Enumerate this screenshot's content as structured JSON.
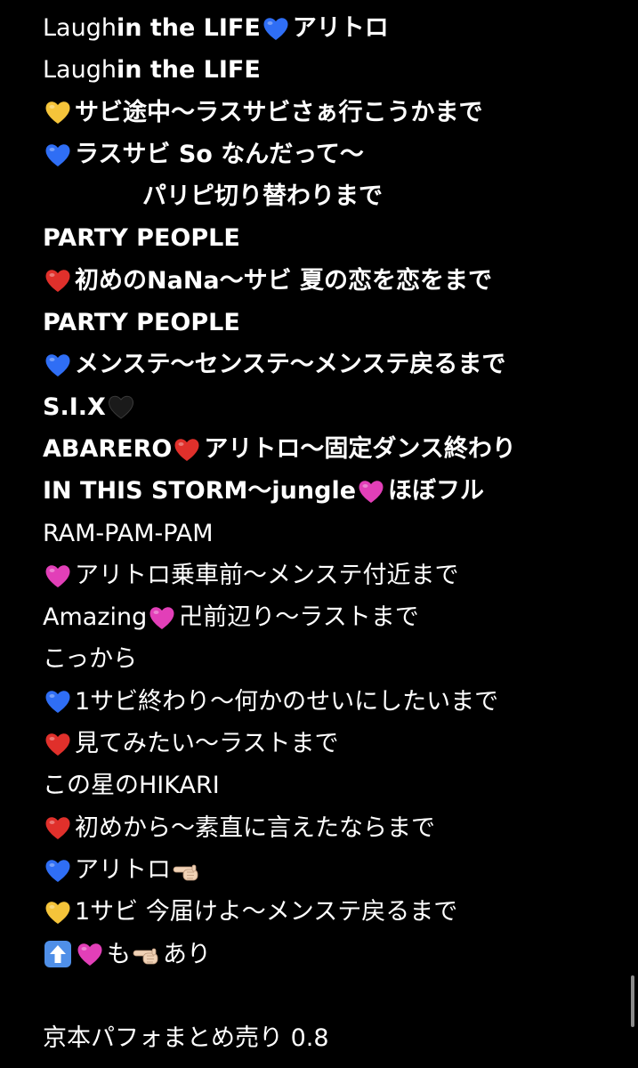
{
  "colors": {
    "background": "#000000",
    "text": "#ffffff",
    "blue_heart": "#2f6ef5",
    "yellow_heart": "#f5c43a",
    "red_heart": "#e0302b",
    "pink_heart": "#e23fb8",
    "black_heart": "#1a1a1a",
    "hand_skin": "#f0d2b6",
    "arrow_box": "#4f8fe8"
  },
  "note": {
    "lines": [
      {
        "segments": [
          {
            "text": "Laugh "
          },
          {
            "text": "in the LIFE "
          },
          {
            "icon": "blue-heart-icon"
          },
          {
            "text": "アリトロ"
          }
        ]
      },
      {
        "segments": [
          {
            "text": "Laugh "
          },
          {
            "text": "in the LIFE"
          }
        ]
      },
      {
        "segments": [
          {
            "icon": "yellow-heart-icon"
          },
          {
            "text": "サビ途中〜ラスサビさぁ行こうかまで"
          }
        ]
      },
      {
        "segments": [
          {
            "icon": "blue-heart-icon"
          },
          {
            "text": "ラスサビ So なんだって〜"
          }
        ]
      },
      {
        "segments": [
          {
            "text": "パリピ切り替わりまで"
          }
        ]
      },
      {
        "segments": [
          {
            "text": "PARTY PEOPLE"
          }
        ]
      },
      {
        "segments": [
          {
            "icon": "red-heart-icon"
          },
          {
            "text": "初めのNaNa〜サビ 夏の恋を恋をまで"
          }
        ]
      },
      {
        "segments": [
          {
            "text": "PARTY PEOPLE"
          }
        ]
      },
      {
        "segments": [
          {
            "icon": "blue-heart-icon"
          },
          {
            "text": "メンステ〜センステ〜メンステ戻るまで"
          }
        ]
      },
      {
        "segments": [
          {
            "text": "S.I.X "
          },
          {
            "icon": "black-heart-icon"
          }
        ]
      },
      {
        "segments": [
          {
            "text": "ABARERO"
          },
          {
            "icon": "red-heart-icon"
          },
          {
            "text": "アリトロ〜固定ダンス終わり"
          }
        ]
      },
      {
        "segments": [
          {
            "text": "IN THIS STORM〜jungle"
          },
          {
            "icon": "pink-heart-icon"
          },
          {
            "text": "ほぼフル"
          }
        ]
      },
      {
        "segments": [
          {
            "text": "RAM-PAM-PAM"
          }
        ]
      },
      {
        "segments": [
          {
            "icon": "pink-heart-icon"
          },
          {
            "text": "アリトロ乗車前〜メンステ付近まで"
          }
        ]
      },
      {
        "segments": [
          {
            "text": "Amazing"
          },
          {
            "icon": "pink-heart-icon"
          },
          {
            "text": "卍前辺り〜ラストまで"
          }
        ]
      },
      {
        "segments": [
          {
            "text": "こっから"
          }
        ]
      },
      {
        "segments": [
          {
            "icon": "blue-heart-icon"
          },
          {
            "text": "1サビ終わり〜何かのせいにしたいまで"
          }
        ]
      },
      {
        "segments": [
          {
            "icon": "red-heart-icon"
          },
          {
            "text": "見てみたい〜ラストまで"
          }
        ]
      },
      {
        "segments": [
          {
            "text": "この星のHIKARI"
          }
        ]
      },
      {
        "segments": [
          {
            "icon": "red-heart-icon"
          },
          {
            "text": "初めから〜素直に言えたならまで"
          }
        ]
      },
      {
        "segments": [
          {
            "icon": "blue-heart-icon"
          },
          {
            "text": "アリトロ"
          },
          {
            "icon": "pointing-hand-icon"
          }
        ]
      },
      {
        "segments": [
          {
            "icon": "yellow-heart-icon"
          },
          {
            "text": "1サビ 今届けよ〜メンステ戻るまで"
          }
        ]
      },
      {
        "segments": [
          {
            "icon": "up-arrow-icon"
          },
          {
            "icon": "pink-heart-icon"
          },
          {
            "text": "も"
          },
          {
            "icon": "pointing-hand-icon"
          },
          {
            "text": "あり"
          }
        ]
      },
      {
        "segments": []
      },
      {
        "segments": [
          {
            "text": "京本パフォまとめ売り 0.8"
          }
        ]
      }
    ]
  }
}
